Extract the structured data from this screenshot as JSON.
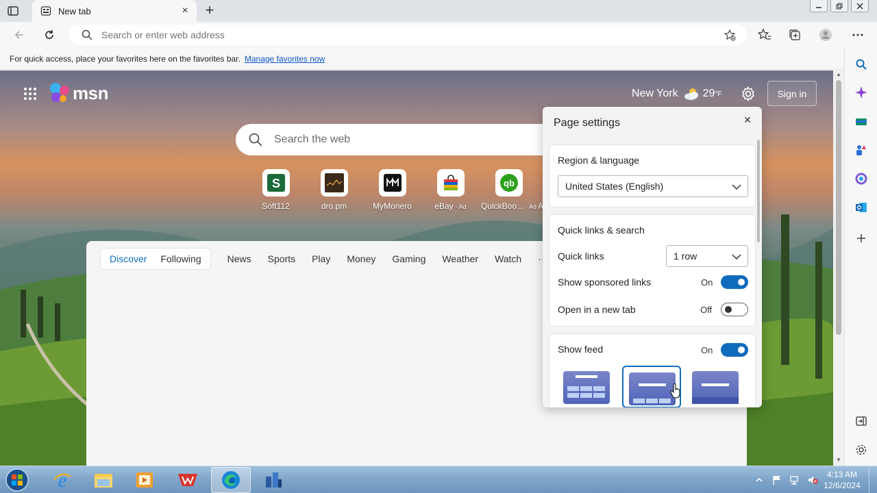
{
  "browser": {
    "tab": {
      "title": "New tab"
    },
    "address": {
      "placeholder": "Search or enter web address"
    },
    "favorites_bar": {
      "message": "For quick access, place your favorites here on the favorites bar.",
      "link": "Manage favorites now"
    }
  },
  "msn": {
    "logo_text": "msn",
    "weather": {
      "city": "New York",
      "temp": "29",
      "unit": "°F"
    },
    "signin_label": "Sign in",
    "search_placeholder": "Search the web",
    "quick_links": [
      {
        "label": "Soft112",
        "ad": ""
      },
      {
        "label": "dro.pm",
        "ad": ""
      },
      {
        "label": "MyMonero",
        "ad": ""
      },
      {
        "label": "eBay",
        "ad": "· Ad"
      },
      {
        "label": "QuickBoo...",
        "ad": "· Ad"
      },
      {
        "label": "A",
        "ad": ""
      }
    ],
    "feed_pills": [
      "Discover",
      "Following"
    ],
    "feed_tabs": [
      "News",
      "Sports",
      "Play",
      "Money",
      "Gaming",
      "Weather",
      "Watch",
      "···"
    ]
  },
  "page_settings": {
    "title": "Page settings",
    "region": {
      "heading": "Region & language",
      "selected": "United States (English)"
    },
    "quick_links_search": {
      "heading": "Quick links & search",
      "quick_links_label": "Quick links",
      "quick_links_value": "1 row",
      "sponsored_label": "Show sponsored links",
      "sponsored_state": "On",
      "new_tab_label": "Open in a new tab",
      "new_tab_state": "Off"
    },
    "feed": {
      "heading": "Show feed",
      "state": "On"
    }
  },
  "taskbar": {
    "time": "4:13 AM",
    "date": "12/6/2024"
  },
  "colors": {
    "accent": "#0f6cbd",
    "taskbar": "#7fa5c8"
  }
}
